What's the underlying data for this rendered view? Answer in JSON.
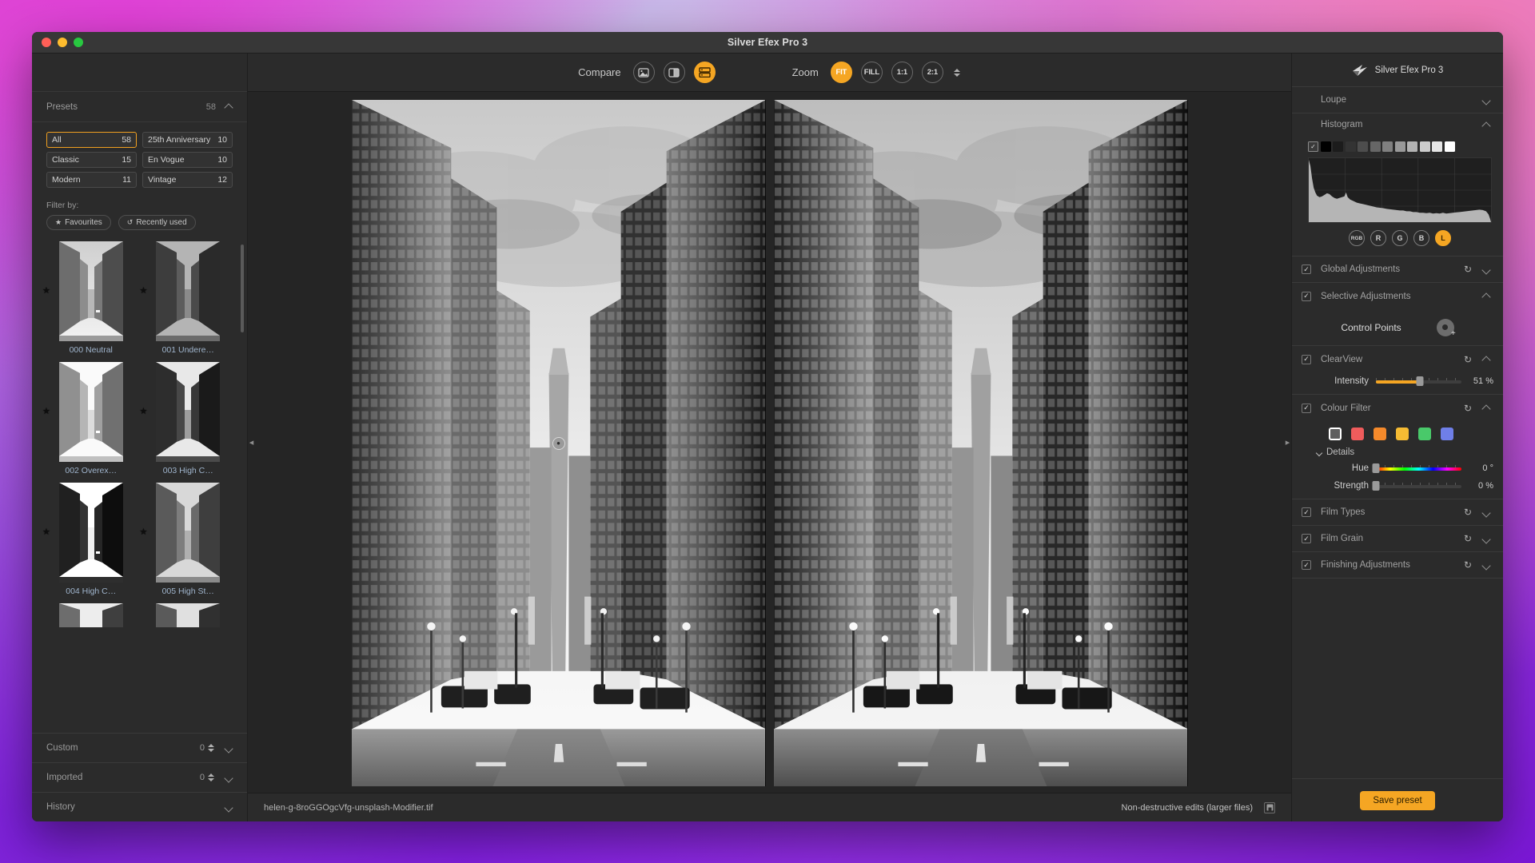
{
  "window": {
    "title": "Silver Efex Pro 3"
  },
  "sidebar": {
    "presets": {
      "label": "Presets",
      "count": "58"
    },
    "categories": [
      {
        "name": "All",
        "count": "58",
        "selected": true
      },
      {
        "name": "25th Anniversary",
        "count": "10",
        "selected": false
      },
      {
        "name": "Classic",
        "count": "15",
        "selected": false
      },
      {
        "name": "En Vogue",
        "count": "10",
        "selected": false
      },
      {
        "name": "Modern",
        "count": "11",
        "selected": false
      },
      {
        "name": "Vintage",
        "count": "12",
        "selected": false
      }
    ],
    "filter_label": "Filter by:",
    "pills": [
      {
        "icon": "star-icon",
        "glyph": "★",
        "label": "Favourites"
      },
      {
        "icon": "history-icon",
        "glyph": "↺",
        "label": "Recently used"
      }
    ],
    "preset_items": [
      {
        "name": "000 Neutral",
        "favourite": true
      },
      {
        "name": "001 Undere…",
        "favourite": true
      },
      {
        "name": "002 Overex…",
        "favourite": true
      },
      {
        "name": "003 High C…",
        "favourite": true
      },
      {
        "name": "004 High C…",
        "favourite": true
      },
      {
        "name": "005 High St…",
        "favourite": true
      }
    ],
    "rows": [
      {
        "label": "Custom",
        "count": "0",
        "has_stepper": true
      },
      {
        "label": "Imported",
        "count": "0",
        "has_stepper": true
      },
      {
        "label": "History",
        "count": "",
        "has_stepper": false
      }
    ]
  },
  "toolbar": {
    "compare_label": "Compare",
    "compare_buttons": [
      {
        "name": "single-view-button",
        "icon": "image-icon",
        "active": false
      },
      {
        "name": "split-view-button",
        "icon": "split-image-icon",
        "active": false
      },
      {
        "name": "side-by-side-button",
        "icon": "side-by-side-icon",
        "active": true
      }
    ],
    "zoom_label": "Zoom",
    "zoom_buttons": [
      {
        "label": "FIT",
        "active": true
      },
      {
        "label": "FILL",
        "active": false
      },
      {
        "label": "1:1",
        "active": false
      },
      {
        "label": "2:1",
        "active": false
      }
    ]
  },
  "statusbar": {
    "filename": "helen-g-8roGGOgcVfg-unsplash-Modifier.tif",
    "nondestructive_label": "Non-destructive edits (larger files)"
  },
  "right_panel": {
    "brand": "Silver Efex Pro 3",
    "loupe": {
      "label": "Loupe"
    },
    "histogram": {
      "label": "Histogram",
      "channels": [
        {
          "label": "RGB",
          "active": false
        },
        {
          "label": "R",
          "active": false
        },
        {
          "label": "G",
          "active": false
        },
        {
          "label": "B",
          "active": false
        },
        {
          "label": "L",
          "active": true
        }
      ]
    },
    "global_adjustments": {
      "label": "Global Adjustments",
      "checked": true
    },
    "selective_adjustments": {
      "label": "Selective Adjustments",
      "checked": true
    },
    "control_points": {
      "label": "Control Points"
    },
    "clearview": {
      "label": "ClearView",
      "checked": true,
      "intensity": {
        "label": "Intensity",
        "value": "51 %",
        "percent": 51
      }
    },
    "colour_filter": {
      "label": "Colour Filter",
      "checked": true,
      "swatches": [
        "#5e5e5e",
        "#ef5c5c",
        "#f58a2b",
        "#f5bb33",
        "#49c96a",
        "#6f7fe8"
      ],
      "selected_index": 0,
      "details_label": "Details",
      "hue": {
        "label": "Hue",
        "value": "0 °",
        "percent": 0
      },
      "strength": {
        "label": "Strength",
        "value": "0 %",
        "percent": 0
      }
    },
    "sections": [
      {
        "label": "Film Types",
        "checked": true
      },
      {
        "label": "Film Grain",
        "checked": true
      },
      {
        "label": "Finishing Adjustments",
        "checked": true
      }
    ],
    "save_preset": "Save preset"
  },
  "colors": {
    "accent": "#f5a623",
    "panel_bg": "#2b2b2b",
    "link": "#9fb4cc"
  }
}
